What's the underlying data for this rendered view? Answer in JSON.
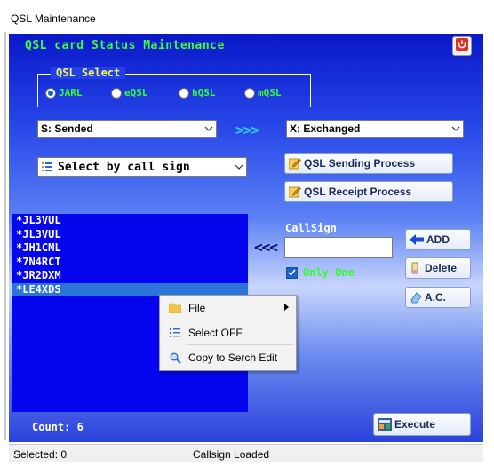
{
  "window": {
    "title": "QSL Maintenance"
  },
  "header": {
    "title": "QSL card Status Maintenance",
    "power_icon": "power-icon"
  },
  "qsl_select": {
    "legend": "QSL Select",
    "options": [
      "JARL",
      "eQSL",
      "hQSL",
      "mQSL"
    ],
    "selected": "JARL"
  },
  "filters": {
    "from_status": "S: Sended",
    "arrows": ">>>",
    "to_status": "X: Exchanged",
    "select_mode": "Select by call sign"
  },
  "buttons": {
    "sending": "QSL Sending Process",
    "receipt": "QSL Receipt Process",
    "add": "ADD",
    "delete": "Delete",
    "ac": "A.C.",
    "execute": "Execute"
  },
  "list": {
    "items": [
      "*JL3VUL",
      "*JL3VUL",
      "*JH1CML",
      "*7N4RCT",
      "*JR2DXM",
      "*LE4XDS"
    ],
    "selected_index": 5
  },
  "callsign": {
    "arrows": "<<<",
    "label": "CallSign",
    "value": "",
    "only_one_label": "Only One",
    "only_one_checked": true
  },
  "count_label": "Count: 6",
  "context_menu": {
    "items": [
      {
        "label": "File",
        "icon": "folder-icon",
        "has_submenu": true
      },
      {
        "label": "Select OFF",
        "icon": "list-icon"
      },
      {
        "label": "Copy to Serch Edit",
        "icon": "magnifier-icon"
      }
    ]
  },
  "status_bar": {
    "selected": "Selected: 0",
    "message": "Callsign Loaded"
  },
  "colors": {
    "accent_green": "#3cff3c",
    "legend_yellow": "#fff25a",
    "list_bg": "#0505ee",
    "selection": "#2b74d8"
  }
}
